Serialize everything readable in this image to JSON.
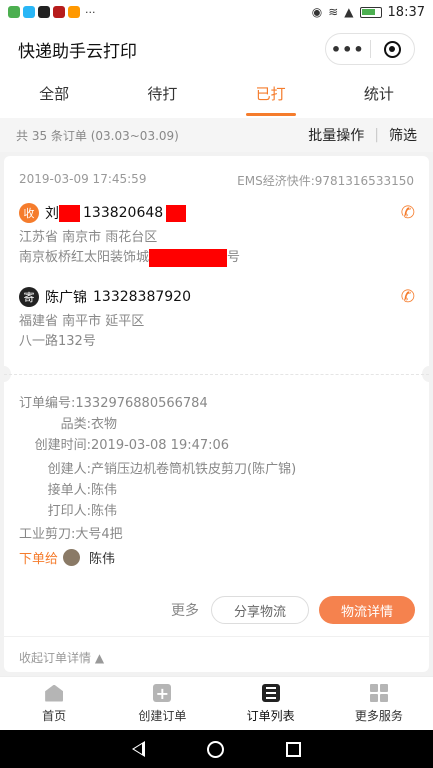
{
  "statusbar": {
    "time": "18:37",
    "more": "···",
    "apps": [
      "#4caf50",
      "#29b6f6",
      "#222222",
      "#b71c1c",
      "#ff9800"
    ]
  },
  "titlebar": {
    "title": "快递助手云打印",
    "more_icon": "•••"
  },
  "tabs": [
    {
      "label": "全部",
      "active": false
    },
    {
      "label": "待打",
      "active": false
    },
    {
      "label": "已打",
      "active": true
    },
    {
      "label": "统计",
      "active": false
    }
  ],
  "filter": {
    "count": "共 35 条订单 (03.03~03.09)",
    "batch": "批量操作",
    "divider": "|",
    "filter": "筛选"
  },
  "order": {
    "datetime": "2019-03-09 17:45:59",
    "carrier_tracking": "EMS经济快件:9781316533150",
    "recipient": {
      "badge": "收",
      "name_prefix": "刘",
      "phone_visible": "133820648",
      "province_city": "江苏省 南京市 雨花台区",
      "street_prefix": "南京板桥红太阳装饰城",
      "street_suffix": "号"
    },
    "sender": {
      "badge": "寄",
      "name": "陈广锦",
      "phone": "13328387920",
      "province_city": "福建省 南平市 延平区",
      "street": "八一路132号"
    },
    "details": [
      {
        "label": "订单编号:",
        "value": "1332976880566784"
      },
      {
        "label": "品类:",
        "value": "衣物"
      },
      {
        "label": "创建时间:",
        "value": "2019-03-08 19:47:06"
      },
      {
        "label": "创建人:",
        "value": "产销压边机卷筒机铁皮剪刀(陈广锦)"
      },
      {
        "label": "接单人:",
        "value": "陈伟"
      },
      {
        "label": "打印人:",
        "value": "陈伟"
      }
    ],
    "item_note": "工业剪刀:大号4把",
    "assign_label": "下单给",
    "assign_name": "陈伟",
    "more_label": "更多",
    "share_label": "分享物流",
    "track_label": "物流详情",
    "collapse_label": "收起订单详情 ▲"
  },
  "bottomnav": [
    {
      "label": "首页",
      "icon": "home-icon"
    },
    {
      "label": "创建订单",
      "icon": "add-order-icon"
    },
    {
      "label": "订单列表",
      "icon": "order-list-icon",
      "active": true
    },
    {
      "label": "更多服务",
      "icon": "more-services-icon"
    }
  ],
  "colors": {
    "accent": "#f57c2c",
    "redaction": "#ff0000"
  }
}
